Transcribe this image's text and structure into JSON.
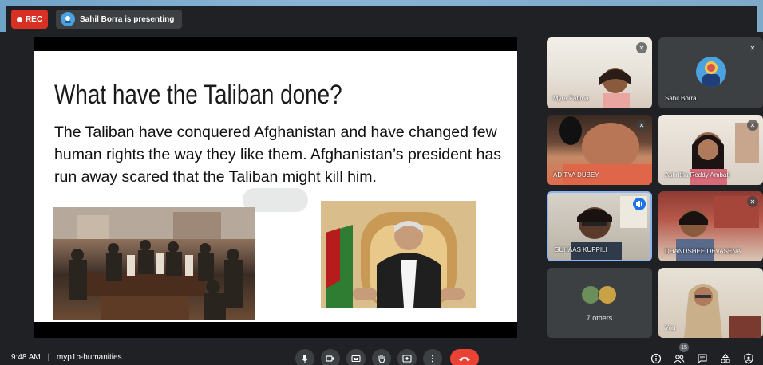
{
  "topbar": {
    "rec_label": "REC",
    "presenting_text": "Sahil Borra is presenting"
  },
  "slide": {
    "title": "What have the Taliban done?",
    "body": "The Taliban have conquered Afghanistan and have changed few human rights the way they like them. Afghanistan’s president has run away scared that the Taliban might kill him."
  },
  "participants": [
    {
      "name": "Myra Fatima",
      "muted": true
    },
    {
      "name": "Sahil Borra",
      "muted": true
    },
    {
      "name": "ADITYA DUBEY",
      "muted": true
    },
    {
      "name": "Ashritha Reddy Ambati",
      "muted": true
    },
    {
      "name": "SUHAAS KUPPILI",
      "muted": false,
      "speaking": true
    },
    {
      "name": "DHANUSHEE DEVASENA",
      "muted": true
    },
    {
      "name": "You",
      "muted": false
    }
  ],
  "others": {
    "label": "7 others"
  },
  "bottombar": {
    "time": "9:48 AM",
    "separator": "|",
    "meeting_code": "myp1b-humanities",
    "people_count": "15"
  },
  "icons": [
    "record-dot-icon",
    "presenter-icon",
    "mic-icon",
    "camera-icon",
    "captions-icon",
    "raise-hand-icon",
    "present-icon",
    "more-options-icon",
    "end-call-icon",
    "info-icon",
    "people-icon",
    "chat-icon",
    "activities-icon",
    "host-controls-icon",
    "mic-off-icon",
    "speaking-icon"
  ],
  "colors": {
    "rec_red": "#d93025",
    "end_call": "#ea4335",
    "speaking_blue": "#1a73e8",
    "meet_dark": "#202124"
  }
}
